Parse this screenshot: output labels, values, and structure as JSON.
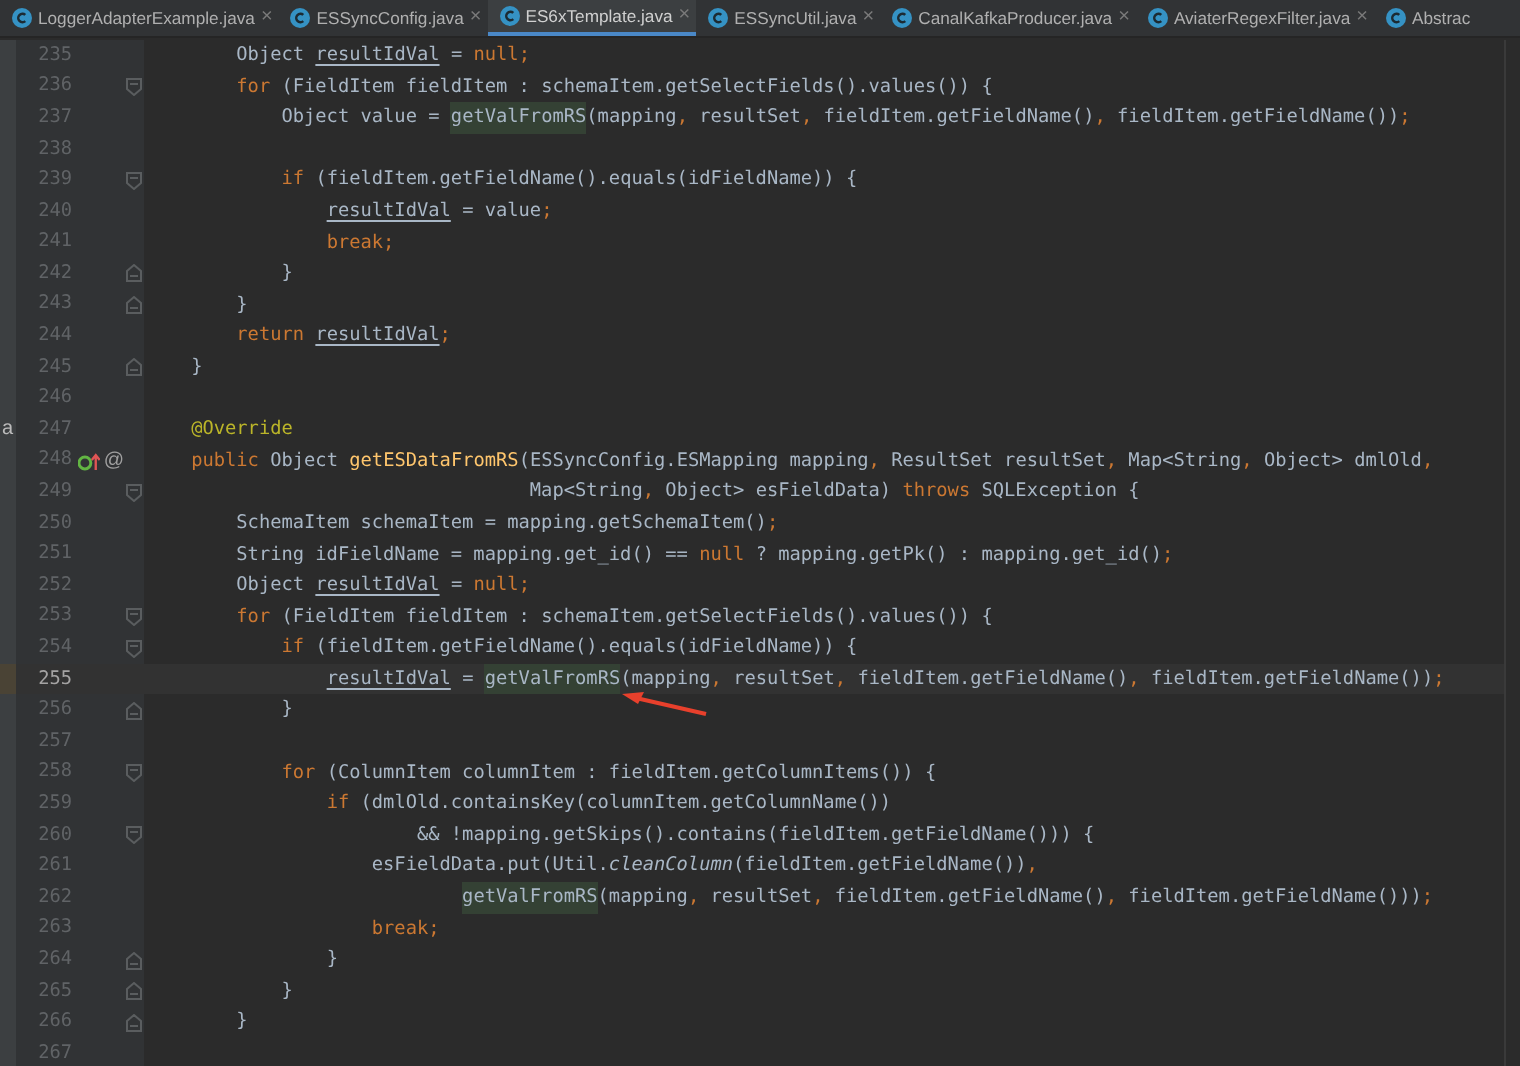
{
  "tabs": [
    {
      "label": "LoggerAdapterExample.java",
      "close": "×",
      "selected": false
    },
    {
      "label": "ESSyncConfig.java",
      "close": "×",
      "selected": false
    },
    {
      "label": "ES6xTemplate.java",
      "close": "×",
      "selected": true
    },
    {
      "label": "ESSyncUtil.java",
      "close": "×",
      "selected": false
    },
    {
      "label": "CanalKafkaProducer.java",
      "close": "×",
      "selected": false
    },
    {
      "label": "AviaterRegexFilter.java",
      "close": "×",
      "selected": false
    },
    {
      "label": "Abstrac",
      "selected": false
    }
  ],
  "lines": [
    {
      "number": "235",
      "current": false,
      "tokens": [
        {
          "kind": "plain",
          "text": "        Object "
        },
        {
          "kind": "var",
          "text": "resultIdVal"
        },
        {
          "kind": "plain",
          "text": " = "
        },
        {
          "kind": "keyword",
          "text": "null"
        },
        {
          "kind": "punct",
          "text": ";"
        }
      ]
    },
    {
      "number": "236",
      "current": false,
      "fold_open": true,
      "tokens": [
        {
          "kind": "keyword",
          "text": "        for"
        },
        {
          "kind": "plain",
          "text": " (FieldItem fieldItem : schemaItem.getSelectFields().values()) {"
        }
      ]
    },
    {
      "number": "237",
      "current": false,
      "tokens": [
        {
          "kind": "plain",
          "text": "            Object value = "
        },
        {
          "kind": "usage",
          "text": "getValFromRS"
        },
        {
          "kind": "plain",
          "text": "(mapping"
        },
        {
          "kind": "punct",
          "text": ","
        },
        {
          "kind": "plain",
          "text": " resultSet"
        },
        {
          "kind": "punct",
          "text": ","
        },
        {
          "kind": "plain",
          "text": " fieldItem.getFieldName()"
        },
        {
          "kind": "punct",
          "text": ","
        },
        {
          "kind": "plain",
          "text": " fieldItem.getFieldName())"
        },
        {
          "kind": "punct",
          "text": ";"
        }
      ]
    },
    {
      "number": "238",
      "current": false
    },
    {
      "number": "239",
      "current": false,
      "fold_open": true,
      "tokens": [
        {
          "kind": "keyword",
          "text": "            if"
        },
        {
          "kind": "plain",
          "text": " (fieldItem.getFieldName().equals(idFieldName)) {"
        }
      ]
    },
    {
      "number": "240",
      "current": false,
      "tokens": [
        {
          "kind": "var",
          "text": "                resultIdVal"
        },
        {
          "kind": "plain",
          "text": " = value"
        },
        {
          "kind": "punct",
          "text": ";"
        }
      ]
    },
    {
      "number": "241",
      "current": false,
      "tokens": [
        {
          "kind": "keyword",
          "text": "                break"
        },
        {
          "kind": "punct",
          "text": ";"
        }
      ]
    },
    {
      "number": "242",
      "current": false,
      "fold_close": true,
      "tokens": [
        {
          "kind": "plain",
          "text": "            }"
        }
      ]
    },
    {
      "number": "243",
      "current": false,
      "fold_close": true,
      "tokens": [
        {
          "kind": "plain",
          "text": "        }"
        }
      ]
    },
    {
      "number": "244",
      "current": false,
      "tokens": [
        {
          "kind": "keyword",
          "text": "        return"
        },
        {
          "kind": "var",
          "text": " resultIdVal"
        },
        {
          "kind": "punct",
          "text": ";"
        }
      ]
    },
    {
      "number": "245",
      "current": false,
      "fold_close": true,
      "tokens": [
        {
          "kind": "plain",
          "text": "    }"
        }
      ]
    },
    {
      "number": "246",
      "current": false
    },
    {
      "number": "247",
      "current": false,
      "side_text": "a",
      "tokens": [
        {
          "kind": "annotation",
          "text": "    @Override"
        }
      ]
    },
    {
      "number": "248",
      "current": false,
      "override_marker": true,
      "annotation_marker": "@",
      "tokens": [
        {
          "kind": "keyword",
          "text": "    public"
        },
        {
          "kind": "plain",
          "text": " Object "
        },
        {
          "kind": "method",
          "text": "getESDataFromRS"
        },
        {
          "kind": "plain",
          "text": "(ESSyncConfig.ESMapping mapping"
        },
        {
          "kind": "punct",
          "text": ","
        },
        {
          "kind": "plain",
          "text": " ResultSet resultSet"
        },
        {
          "kind": "punct",
          "text": ","
        },
        {
          "kind": "plain",
          "text": " Map<String"
        },
        {
          "kind": "punct",
          "text": ","
        },
        {
          "kind": "plain",
          "text": " Object> dmlOld"
        },
        {
          "kind": "punct",
          "text": ","
        }
      ]
    },
    {
      "number": "249",
      "current": false,
      "fold_open": true,
      "tokens": [
        {
          "kind": "plain",
          "text": "                                  Map<String"
        },
        {
          "kind": "punct",
          "text": ","
        },
        {
          "kind": "plain",
          "text": " Object> esFieldData) "
        },
        {
          "kind": "keyword",
          "text": "throws"
        },
        {
          "kind": "plain",
          "text": " SQLException {"
        }
      ]
    },
    {
      "number": "250",
      "current": false,
      "tokens": [
        {
          "kind": "plain",
          "text": "        SchemaItem schemaItem = mapping.getSchemaItem()"
        },
        {
          "kind": "punct",
          "text": ";"
        }
      ]
    },
    {
      "number": "251",
      "current": false,
      "tokens": [
        {
          "kind": "plain",
          "text": "        String idFieldName = mapping.get_id() == "
        },
        {
          "kind": "keyword",
          "text": "null"
        },
        {
          "kind": "plain",
          "text": " ? mapping.getPk() : mapping.get_id()"
        },
        {
          "kind": "punct",
          "text": ";"
        }
      ]
    },
    {
      "number": "252",
      "current": false,
      "tokens": [
        {
          "kind": "plain",
          "text": "        Object "
        },
        {
          "kind": "var",
          "text": "resultIdVal"
        },
        {
          "kind": "plain",
          "text": " = "
        },
        {
          "kind": "keyword",
          "text": "null"
        },
        {
          "kind": "punct",
          "text": ";"
        }
      ]
    },
    {
      "number": "253",
      "current": false,
      "fold_open": true,
      "tokens": [
        {
          "kind": "keyword",
          "text": "        for"
        },
        {
          "kind": "plain",
          "text": " (FieldItem fieldItem : schemaItem.getSelectFields().values()) {"
        }
      ]
    },
    {
      "number": "254",
      "current": false,
      "fold_open": true,
      "tokens": [
        {
          "kind": "keyword",
          "text": "            if"
        },
        {
          "kind": "plain",
          "text": " (fieldItem.getFieldName().equals(idFieldName)) {"
        }
      ]
    },
    {
      "number": "255",
      "current": true,
      "tokens": [
        {
          "kind": "var",
          "text": "                resultIdVal"
        },
        {
          "kind": "plain",
          "text": " = "
        },
        {
          "kind": "usage",
          "text": "getValFromRS"
        },
        {
          "kind": "plain",
          "text": "(mapping"
        },
        {
          "kind": "punct",
          "text": ","
        },
        {
          "kind": "plain",
          "text": " resultSet"
        },
        {
          "kind": "punct",
          "text": ","
        },
        {
          "kind": "plain",
          "text": " fieldItem.getFieldName()"
        },
        {
          "kind": "punct",
          "text": ","
        },
        {
          "kind": "plain",
          "text": " fieldItem.getFieldName())"
        },
        {
          "kind": "punct",
          "text": ";"
        }
      ]
    },
    {
      "number": "256",
      "current": false,
      "fold_close": true,
      "tokens": [
        {
          "kind": "plain",
          "text": "            }"
        }
      ]
    },
    {
      "number": "257",
      "current": false
    },
    {
      "number": "258",
      "current": false,
      "fold_open": true,
      "tokens": [
        {
          "kind": "keyword",
          "text": "            for"
        },
        {
          "kind": "plain",
          "text": " (ColumnItem columnItem : fieldItem.getColumnItems()) {"
        }
      ]
    },
    {
      "number": "259",
      "current": false,
      "tokens": [
        {
          "kind": "keyword",
          "text": "                if"
        },
        {
          "kind": "plain",
          "text": " (dmlOld.containsKey(columnItem.getColumnName())"
        }
      ]
    },
    {
      "number": "260",
      "current": false,
      "fold_open": true,
      "tokens": [
        {
          "kind": "plain",
          "text": "                        && !mapping.getSkips().contains(fieldItem.getFieldName())) {"
        }
      ]
    },
    {
      "number": "261",
      "current": false,
      "tokens": [
        {
          "kind": "plain",
          "text": "                    esFieldData.put(Util."
        },
        {
          "kind": "static",
          "text": "cleanColumn"
        },
        {
          "kind": "plain",
          "text": "(fieldItem.getFieldName())"
        },
        {
          "kind": "punct",
          "text": ","
        }
      ]
    },
    {
      "number": "262",
      "current": false,
      "tokens": [
        {
          "kind": "usage",
          "text": "                            getValFromRS"
        },
        {
          "kind": "plain",
          "text": "(mapping"
        },
        {
          "kind": "punct",
          "text": ","
        },
        {
          "kind": "plain",
          "text": " resultSet"
        },
        {
          "kind": "punct",
          "text": ","
        },
        {
          "kind": "plain",
          "text": " fieldItem.getFieldName()"
        },
        {
          "kind": "punct",
          "text": ","
        },
        {
          "kind": "plain",
          "text": " fieldItem.getFieldName()))"
        },
        {
          "kind": "punct",
          "text": ";"
        }
      ]
    },
    {
      "number": "263",
      "current": false,
      "tokens": [
        {
          "kind": "keyword",
          "text": "                    break"
        },
        {
          "kind": "punct",
          "text": ";"
        }
      ]
    },
    {
      "number": "264",
      "current": false,
      "fold_close": true,
      "tokens": [
        {
          "kind": "plain",
          "text": "                }"
        }
      ]
    },
    {
      "number": "265",
      "current": false,
      "fold_close": true,
      "tokens": [
        {
          "kind": "plain",
          "text": "            }"
        }
      ]
    },
    {
      "number": "266",
      "current": false,
      "fold_close": true,
      "tokens": [
        {
          "kind": "plain",
          "text": "        }"
        }
      ]
    },
    {
      "number": "267",
      "current": false
    }
  ]
}
